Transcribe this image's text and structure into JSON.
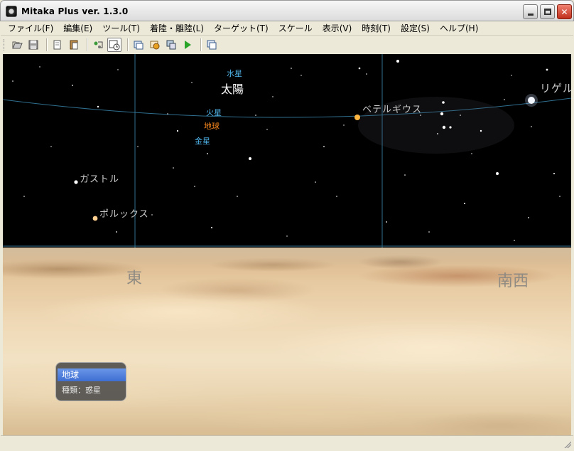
{
  "window": {
    "title": "Mitaka Plus ver. 1.3.0"
  },
  "menu": [
    "ファイル(F)",
    "編集(E)",
    "ツール(T)",
    "着陸・離陸(L)",
    "ターゲット(T)",
    "スケール",
    "表示(V)",
    "時刻(T)",
    "設定(S)",
    "ヘルプ(H)"
  ],
  "toolbar": {
    "icons": [
      "open-icon",
      "save-icon",
      "copy-icon",
      "paste-icon",
      "tool-icon",
      "clock-icon",
      "window-icon",
      "settings-icon",
      "screen-icon",
      "play-icon",
      "fullscreen-icon"
    ]
  },
  "sky": {
    "planet_labels": {
      "mercury": "水星",
      "sun": "太陽",
      "mars": "火星",
      "earth": "地球",
      "venus": "金星"
    },
    "star_labels": {
      "betelgeuse": "ベテルギウス",
      "rigel": "リゲル",
      "castor": "カストル",
      "pollux": "ポルックス"
    },
    "colors": {
      "mercury": "#4fb3e8",
      "mars": "#4fb3e8",
      "venus": "#4fb3e8",
      "earth": "#ff8a1e",
      "grid": "#2f6f8f"
    }
  },
  "ground": {
    "east": "東",
    "southwest": "南西"
  },
  "info_panel": {
    "name": "地球",
    "type": "種類：惑星"
  }
}
